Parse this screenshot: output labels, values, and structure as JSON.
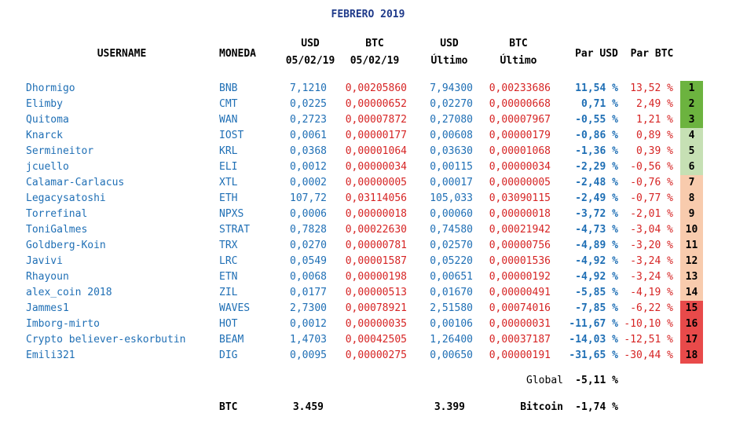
{
  "title": "FEBRERO 2019",
  "headers": {
    "username": "USERNAME",
    "moneda": "MONEDA",
    "usd_start_l1": "USD",
    "usd_start_l2": "05/02/19",
    "btc_start_l1": "BTC",
    "btc_start_l2": "05/02/19",
    "usd_last_l1": "USD",
    "usd_last_l2": "Último",
    "btc_last_l1": "BTC",
    "btc_last_l2": "Último",
    "par_usd": "Par USD",
    "par_btc": "Par BTC"
  },
  "rows": [
    {
      "user": "Dhormigo",
      "coin": "BNB",
      "usd1": "7,1210",
      "btc1": "0,00205860",
      "usd2": "7,94300",
      "btc2": "0,00233686",
      "pusd": "11,54 %",
      "pbtc": "13,52 %",
      "rank": "1",
      "color": "#6cb33f"
    },
    {
      "user": "Elimby",
      "coin": "CMT",
      "usd1": "0,0225",
      "btc1": "0,00000652",
      "usd2": "0,02270",
      "btc2": "0,00000668",
      "pusd": "0,71 %",
      "pbtc": "2,49 %",
      "rank": "2",
      "color": "#6cb33f"
    },
    {
      "user": "Quitoma",
      "coin": "WAN",
      "usd1": "0,2723",
      "btc1": "0,00007872",
      "usd2": "0,27080",
      "btc2": "0,00007967",
      "pusd": "-0,55 %",
      "pbtc": "1,21 %",
      "rank": "3",
      "color": "#6cb33f"
    },
    {
      "user": "Knarck",
      "coin": "IOST",
      "usd1": "0,0061",
      "btc1": "0,00000177",
      "usd2": "0,00608",
      "btc2": "0,00000179",
      "pusd": "-0,86 %",
      "pbtc": "0,89 %",
      "rank": "4",
      "color": "#c6e0b4"
    },
    {
      "user": "Sermineitor",
      "coin": "KRL",
      "usd1": "0,0368",
      "btc1": "0,00001064",
      "usd2": "0,03630",
      "btc2": "0,00001068",
      "pusd": "-1,36 %",
      "pbtc": "0,39 %",
      "rank": "5",
      "color": "#c6e0b4"
    },
    {
      "user": "jcuello",
      "coin": "ELI",
      "usd1": "0,0012",
      "btc1": "0,00000034",
      "usd2": "0,00115",
      "btc2": "0,00000034",
      "pusd": "-2,29 %",
      "pbtc": "-0,56 %",
      "rank": "6",
      "color": "#c6e0b4"
    },
    {
      "user": "Calamar-Carlacus",
      "coin": "XTL",
      "usd1": "0,0002",
      "btc1": "0,00000005",
      "usd2": "0,00017",
      "btc2": "0,00000005",
      "pusd": "-2,48 %",
      "pbtc": "-0,76 %",
      "rank": "7",
      "color": "#f8cbad"
    },
    {
      "user": "Legacysatoshi",
      "coin": "ETH",
      "usd1": "107,72",
      "btc1": "0,03114056",
      "usd2": "105,033",
      "btc2": "0,03090115",
      "pusd": "-2,49 %",
      "pbtc": "-0,77 %",
      "rank": "8",
      "color": "#f8cbad"
    },
    {
      "user": "Torrefinal",
      "coin": "NPXS",
      "usd1": "0,0006",
      "btc1": "0,00000018",
      "usd2": "0,00060",
      "btc2": "0,00000018",
      "pusd": "-3,72 %",
      "pbtc": "-2,01 %",
      "rank": "9",
      "color": "#f8cbad"
    },
    {
      "user": "ToniGalmes",
      "coin": "STRAT",
      "usd1": "0,7828",
      "btc1": "0,00022630",
      "usd2": "0,74580",
      "btc2": "0,00021942",
      "pusd": "-4,73 %",
      "pbtc": "-3,04 %",
      "rank": "10",
      "color": "#f8cbad"
    },
    {
      "user": "Goldberg-Koin",
      "coin": "TRX",
      "usd1": "0,0270",
      "btc1": "0,00000781",
      "usd2": "0,02570",
      "btc2": "0,00000756",
      "pusd": "-4,89 %",
      "pbtc": "-3,20 %",
      "rank": "11",
      "color": "#f8cbad"
    },
    {
      "user": "Javivi",
      "coin": "LRC",
      "usd1": "0,0549",
      "btc1": "0,00001587",
      "usd2": "0,05220",
      "btc2": "0,00001536",
      "pusd": "-4,92 %",
      "pbtc": "-3,24 %",
      "rank": "12",
      "color": "#f8cbad"
    },
    {
      "user": "Rhayoun",
      "coin": "ETN",
      "usd1": "0,0068",
      "btc1": "0,00000198",
      "usd2": "0,00651",
      "btc2": "0,00000192",
      "pusd": "-4,92 %",
      "pbtc": "-3,24 %",
      "rank": "13",
      "color": "#f8cbad"
    },
    {
      "user": "alex_coin 2018",
      "coin": "ZIL",
      "usd1": "0,0177",
      "btc1": "0,00000513",
      "usd2": "0,01670",
      "btc2": "0,00000491",
      "pusd": "-5,85 %",
      "pbtc": "-4,19 %",
      "rank": "14",
      "color": "#f8cbad"
    },
    {
      "user": "Jammes1",
      "coin": "WAVES",
      "usd1": "2,7300",
      "btc1": "0,00078921",
      "usd2": "2,51580",
      "btc2": "0,00074016",
      "pusd": "-7,85 %",
      "pbtc": "-6,22 %",
      "rank": "15",
      "color": "#e84a4a"
    },
    {
      "user": "Imborg-mirto",
      "coin": "HOT",
      "usd1": "0,0012",
      "btc1": "0,00000035",
      "usd2": "0,00106",
      "btc2": "0,00000031",
      "pusd": "-11,67 %",
      "pbtc": "-10,10 %",
      "rank": "16",
      "color": "#e84a4a"
    },
    {
      "user": "Crypto believer-eskorbutin",
      "coin": "BEAM",
      "usd1": "1,4703",
      "btc1": "0,00042505",
      "usd2": "1,26400",
      "btc2": "0,00037187",
      "pusd": "-14,03 %",
      "pbtc": "-12,51 %",
      "rank": "17",
      "color": "#e84a4a"
    },
    {
      "user": "Emili321",
      "coin": "DIG",
      "usd1": "0,0095",
      "btc1": "0,00000275",
      "usd2": "0,00650",
      "btc2": "0,00000191",
      "pusd": "-31,65 %",
      "pbtc": "-30,44 %",
      "rank": "18",
      "color": "#e84a4a"
    }
  ],
  "footer": {
    "global_label": "Global",
    "global_value": "-5,11 %",
    "btc_label": "BTC",
    "btc_start": "3.459",
    "btc_last": "3.399",
    "bitcoin_label": "Bitcoin",
    "bitcoin_value": "-1,74 %"
  }
}
